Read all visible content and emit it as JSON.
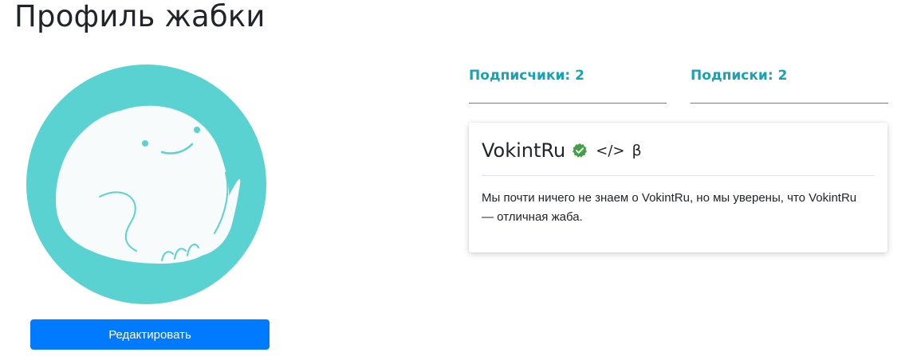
{
  "page": {
    "title": "Профиль жабки"
  },
  "avatar": {
    "icon": "frog-avatar",
    "background_color": "#5bd2d2"
  },
  "actions": {
    "edit_label": "Редактировать"
  },
  "stats": {
    "followers_label": "Подписчики: 2",
    "following_label": "Подписки: 2"
  },
  "profile": {
    "username": "VokintRu",
    "badges": [
      {
        "icon": "verified-check-icon",
        "color": "#43a047"
      },
      {
        "icon": "developer-code-icon",
        "glyph": "</>"
      },
      {
        "icon": "beta-icon",
        "glyph": "β"
      }
    ],
    "description": "Мы почти ничего не знаем о VokintRu, но мы уверены, что VokintRu — отличная жаба."
  },
  "colors": {
    "accent": "#17a2b8",
    "primary_button": "#007bff"
  }
}
